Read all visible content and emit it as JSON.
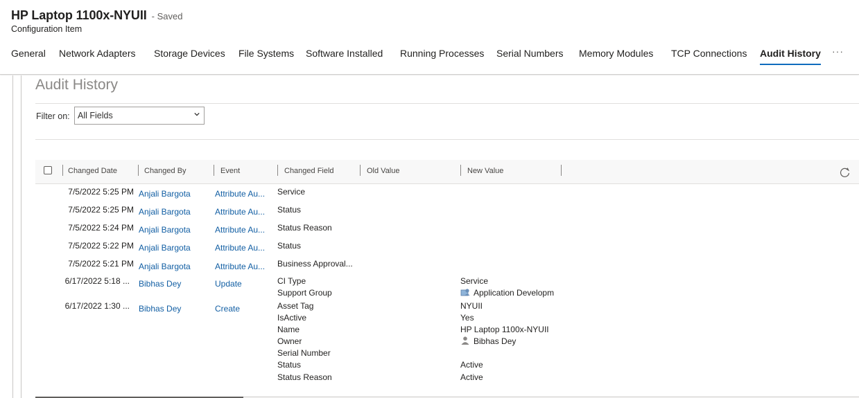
{
  "header": {
    "title": "HP Laptop 1100x-NYUII",
    "saved_status": "- Saved",
    "entity_type": "Configuration Item"
  },
  "tabs": [
    {
      "label": "General"
    },
    {
      "label": "Network Adapters"
    },
    {
      "label": "Storage Devices"
    },
    {
      "label": "File Systems"
    },
    {
      "label": "Software Installed"
    },
    {
      "label": "Running Processes"
    },
    {
      "label": "Serial Numbers"
    },
    {
      "label": "Memory Modules"
    },
    {
      "label": "TCP Connections"
    },
    {
      "label": "Audit History",
      "active": true
    }
  ],
  "more_tabs": "···",
  "section": {
    "title": "Audit History",
    "filter_label": "Filter on:",
    "filter_value": "All Fields"
  },
  "grid": {
    "columns": [
      "Changed Date",
      "Changed By",
      "Event",
      "Changed Field",
      "Old Value",
      "New Value"
    ],
    "rows": [
      {
        "date": "7/5/2022 5:25 PM",
        "by": "Anjali Bargota",
        "event": "Attribute Au...",
        "fields": [
          "Service"
        ],
        "old": [],
        "new": []
      },
      {
        "date": "7/5/2022 5:25 PM",
        "by": "Anjali Bargota",
        "event": "Attribute Au...",
        "fields": [
          "Status"
        ],
        "old": [],
        "new": []
      },
      {
        "date": "7/5/2022 5:24 PM",
        "by": "Anjali Bargota",
        "event": "Attribute Au...",
        "fields": [
          "Status Reason"
        ],
        "old": [],
        "new": []
      },
      {
        "date": "7/5/2022 5:22 PM",
        "by": "Anjali Bargota",
        "event": "Attribute Au...",
        "fields": [
          "Status"
        ],
        "old": [],
        "new": []
      },
      {
        "date": "7/5/2022 5:21 PM",
        "by": "Anjali Bargota",
        "event": "Attribute Au...",
        "fields": [
          "Business Approval..."
        ],
        "old": [],
        "new": []
      },
      {
        "date": "6/17/2022 5:18 ...",
        "by": "Bibhas Dey",
        "event": "Update",
        "fields": [
          "CI Type",
          "Support Group"
        ],
        "old": [],
        "new": [
          "Service",
          "Application Developm"
        ]
      },
      {
        "date": "6/17/2022 1:30 ...",
        "by": "Bibhas Dey",
        "event": "Create",
        "fields": [
          "Asset Tag",
          "IsActive",
          "Name",
          "Owner",
          "Serial Number",
          "Status",
          "Status Reason"
        ],
        "old": [],
        "new": [
          "NYUII",
          "Yes",
          "HP Laptop 1100x-NYUII",
          "Bibhas Dey",
          "",
          "Active",
          "Active"
        ]
      }
    ]
  },
  "icons": {
    "team": "team-icon",
    "user": "user-icon",
    "refresh": "refresh-icon",
    "chevron": "chevron-down-icon"
  },
  "colors": {
    "link": "#115ea3",
    "accent": "#0f6cbd"
  }
}
